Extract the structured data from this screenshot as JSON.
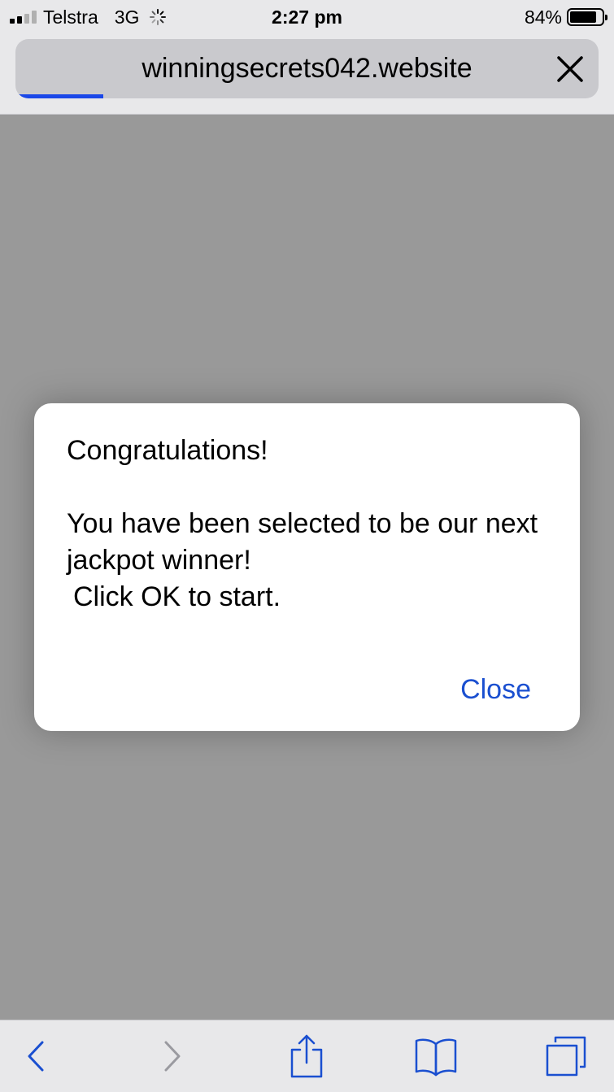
{
  "status_bar": {
    "carrier": "Telstra",
    "network": "3G",
    "time": "2:27 pm",
    "battery_percent_text": "84%",
    "battery_level": 0.84,
    "signal_bars_filled": 2,
    "signal_bars_total": 4
  },
  "address_bar": {
    "url": "winningsecrets042.website",
    "load_progress": 0.15
  },
  "dialog": {
    "line1": "Congratulations!",
    "line2": "You have been selected to be our next jackpot winner!",
    "line3": "Click OK to start.",
    "close_label": "Close"
  },
  "toolbar": {
    "icons": [
      "back-icon",
      "forward-icon",
      "share-icon",
      "bookmarks-icon",
      "tabs-icon"
    ]
  },
  "colors": {
    "accent": "#1a4fd0",
    "progress": "#1a47e8",
    "dim_overlay": "#999999"
  }
}
